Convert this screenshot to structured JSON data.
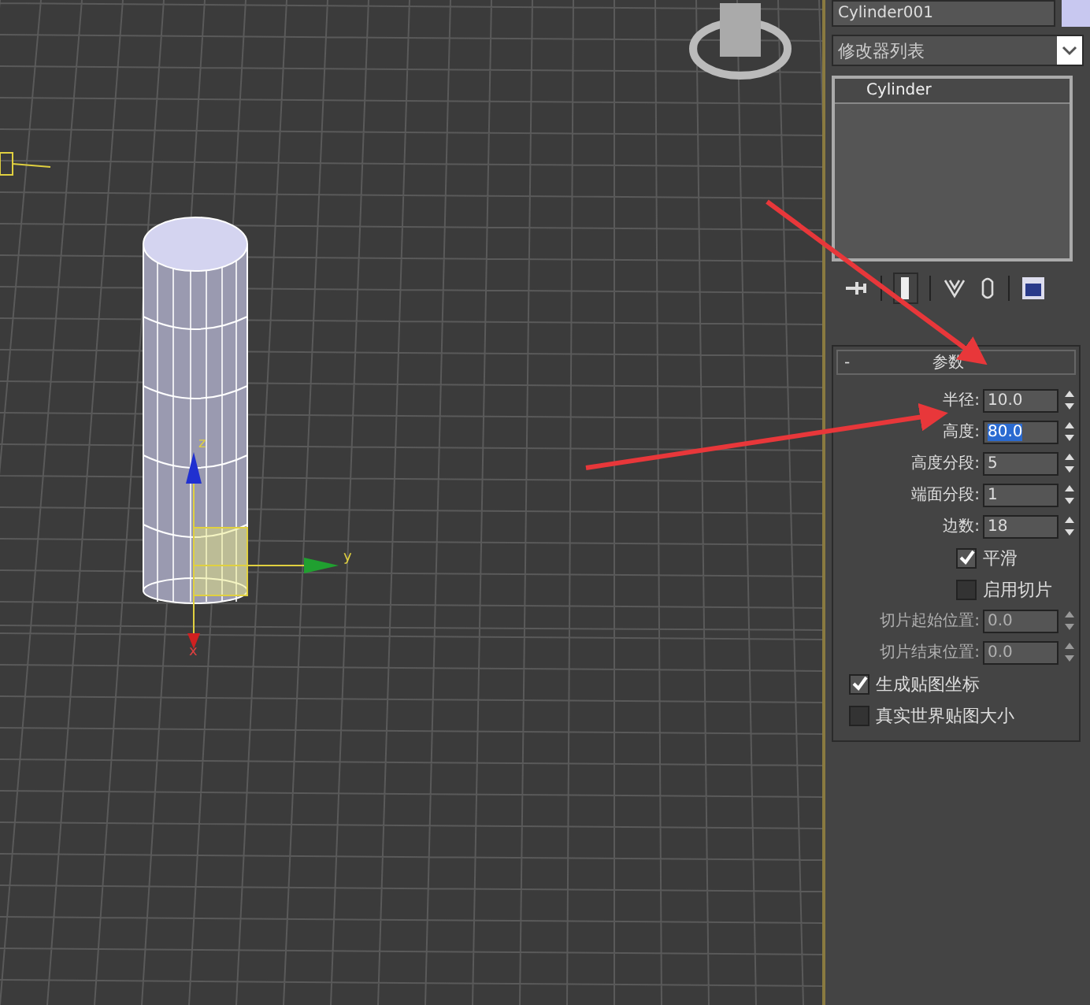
{
  "viewport": {
    "axis_labels": [
      {
        "axis": "z"
      },
      {
        "axis": "y"
      },
      {
        "axis": "x"
      }
    ]
  },
  "modify_panel": {
    "object_name": "Cylinder001",
    "modifier_list": "修改器列表",
    "modifier_stack": [
      {
        "label": "Cylinder",
        "selected": true
      }
    ],
    "parameters": {
      "collapse_sign": "-",
      "title": "参数",
      "rows": [
        {
          "kind": "spinner",
          "label": "半径:",
          "value": "10.0",
          "selected": false,
          "disabled": false
        },
        {
          "kind": "spinner",
          "label": "高度:",
          "value": "80.0",
          "selected": true,
          "disabled": false
        },
        {
          "kind": "spinner",
          "label": "高度分段:",
          "value": "5",
          "selected": false,
          "disabled": false
        },
        {
          "kind": "spinner",
          "label": "端面分段:",
          "value": "1",
          "selected": false,
          "disabled": false
        },
        {
          "kind": "spinner",
          "label": "边数:",
          "value": "18",
          "selected": false,
          "disabled": false
        },
        {
          "kind": "option",
          "label": "平滑",
          "checked": true
        },
        {
          "kind": "option",
          "label": "启用切片",
          "checked": false
        },
        {
          "kind": "spinner",
          "label": "切片起始位置:",
          "value": "0.0",
          "selected": false,
          "disabled": true
        },
        {
          "kind": "spinner",
          "label": "切片结束位置:",
          "value": "0.0",
          "selected": false,
          "disabled": true
        },
        {
          "kind": "checkbox",
          "label": "生成贴图坐标",
          "checked": true
        },
        {
          "kind": "checkbox",
          "label": "真实世界贴图大小",
          "checked": false
        }
      ]
    }
  }
}
